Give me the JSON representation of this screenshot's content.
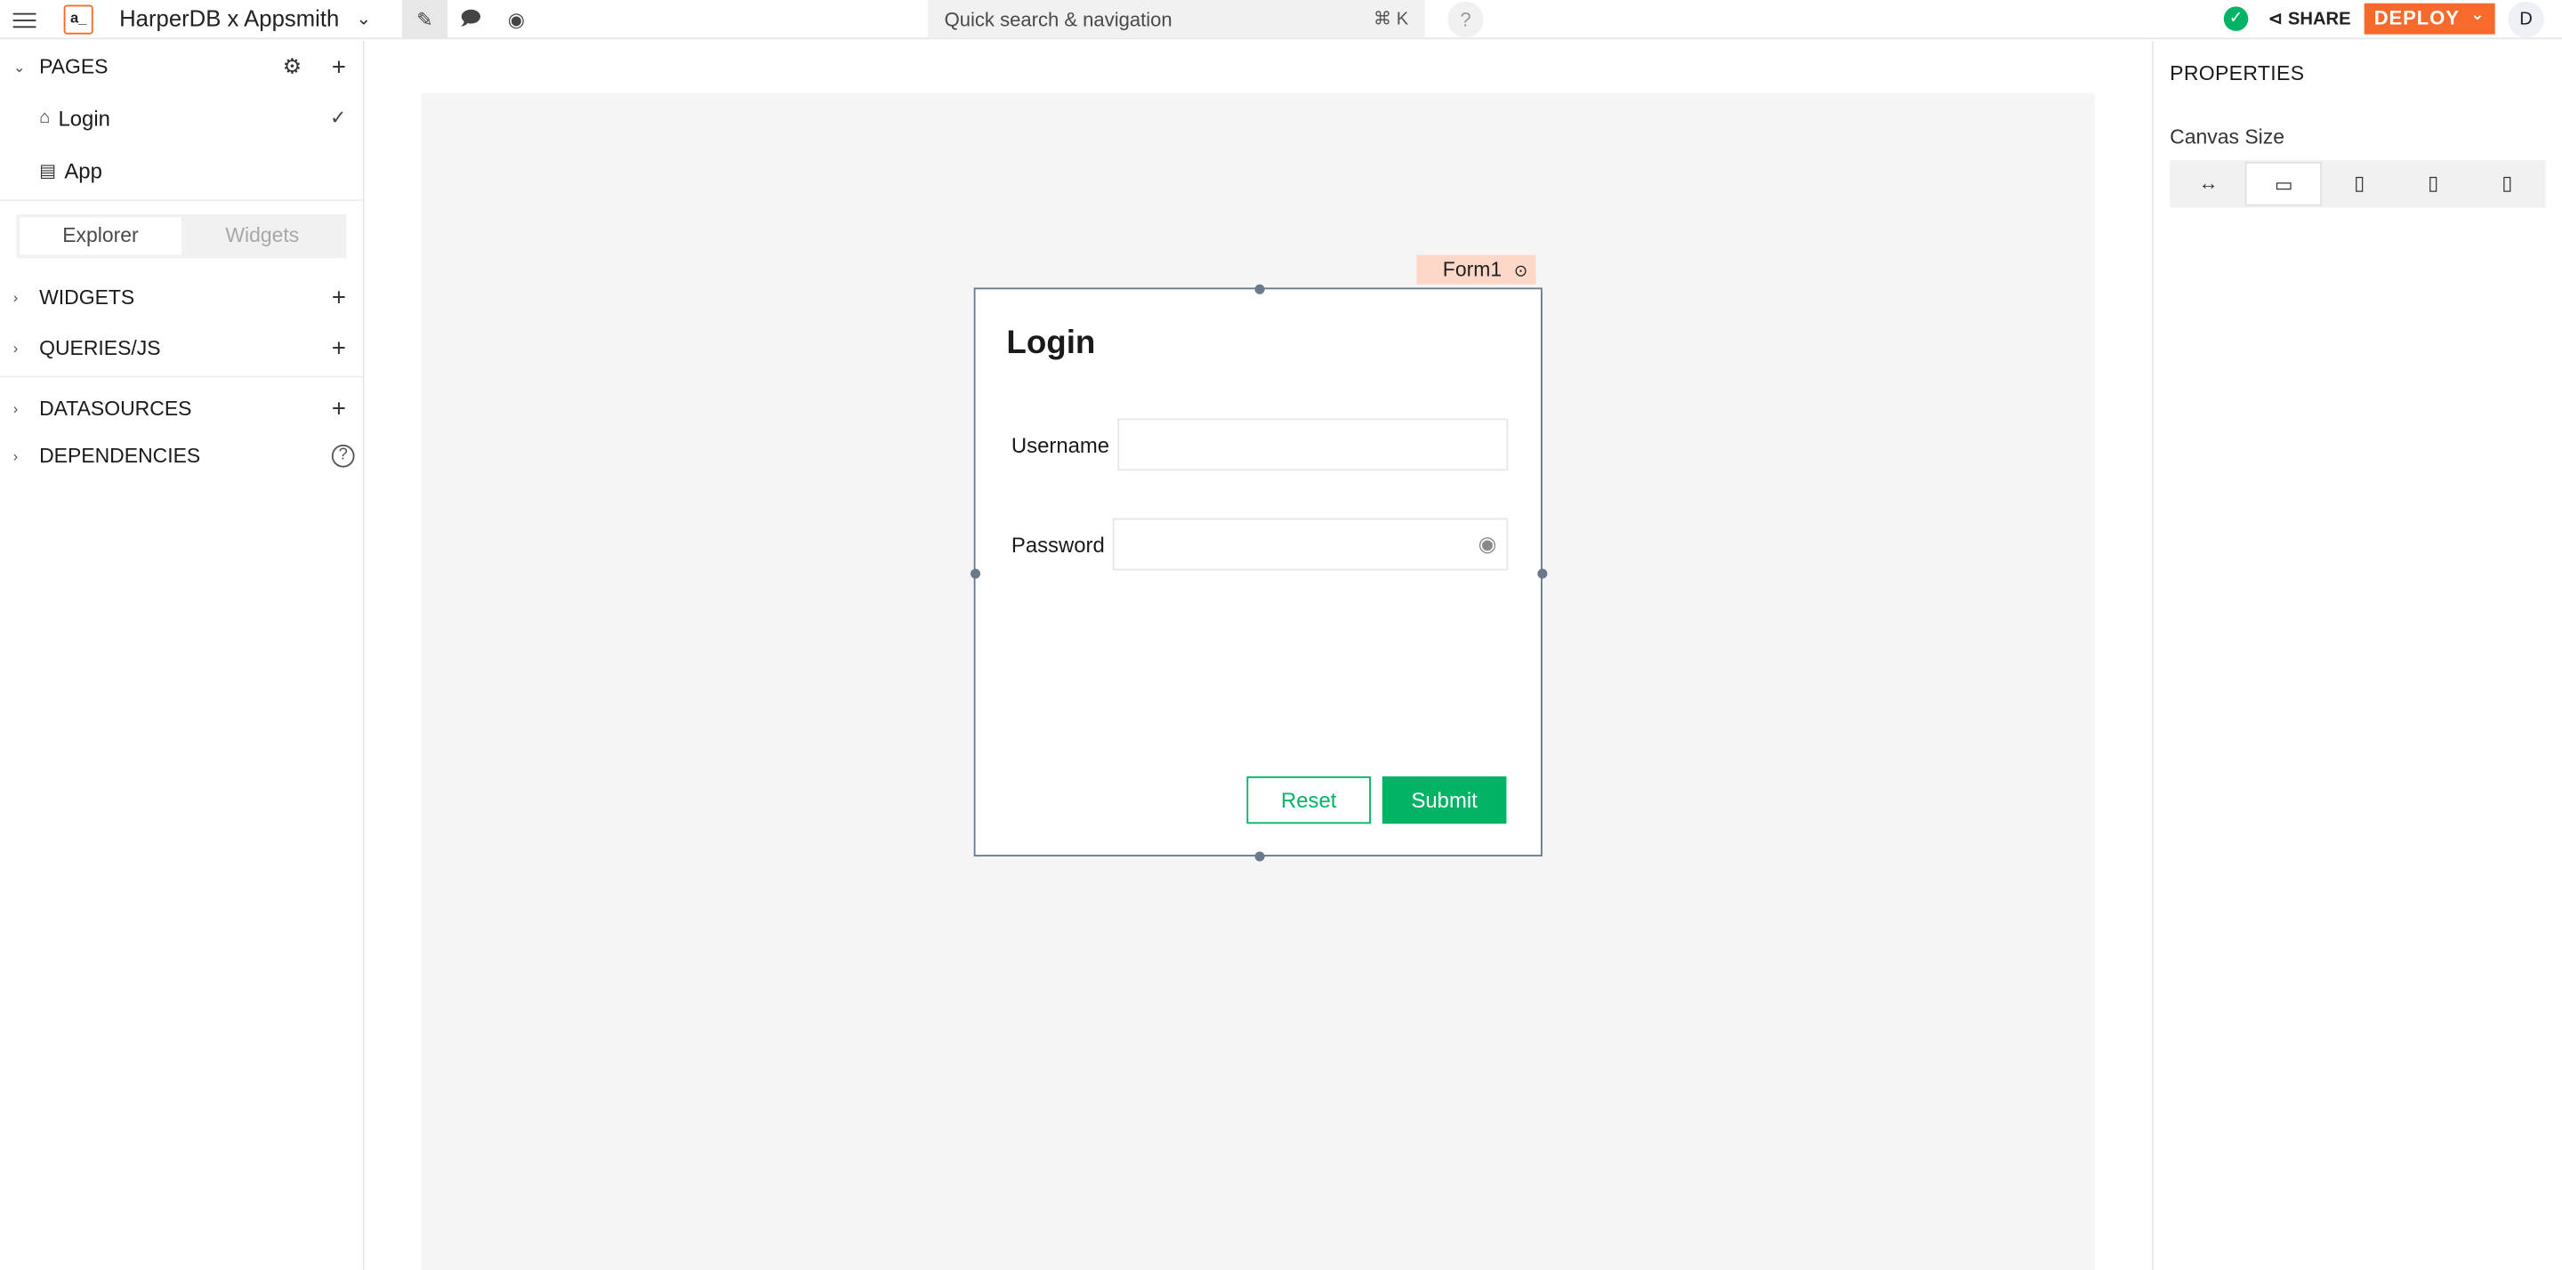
{
  "header": {
    "logo_text": "a_",
    "app_name": "HarperDB x Appsmith",
    "search_placeholder": "Quick search & navigation",
    "search_shortcut": "⌘ K",
    "help": "?",
    "share_label": "SHARE",
    "deploy_label": "DEPLOY",
    "avatar_initial": "D"
  },
  "sidebar": {
    "pages_title": "PAGES",
    "pages": [
      {
        "label": "Login",
        "icon": "home-icon",
        "selected": true
      },
      {
        "label": "App",
        "icon": "page-icon",
        "selected": false
      }
    ],
    "tabs": [
      "Explorer",
      "Widgets"
    ],
    "sections": [
      "WIDGETS",
      "QUERIES/JS",
      "DATASOURCES",
      "DEPENDENCIES"
    ]
  },
  "canvas": {
    "form_tag": "Form1",
    "form_title": "Login",
    "username_label": "Username",
    "username_value": "",
    "password_label": "Password",
    "password_value": "",
    "reset_label": "Reset",
    "submit_label": "Submit"
  },
  "properties": {
    "title": "PROPERTIES",
    "canvas_size_label": "Canvas Size",
    "size_options": [
      "fluid-width-icon",
      "desktop-icon",
      "tablet-landscape-icon",
      "tablet-icon",
      "mobile-icon"
    ],
    "selected_size": "desktop-icon"
  },
  "colors": {
    "accent": "#f86a2b",
    "success": "#03b365",
    "form_tag_bg": "#fdd7c7"
  }
}
